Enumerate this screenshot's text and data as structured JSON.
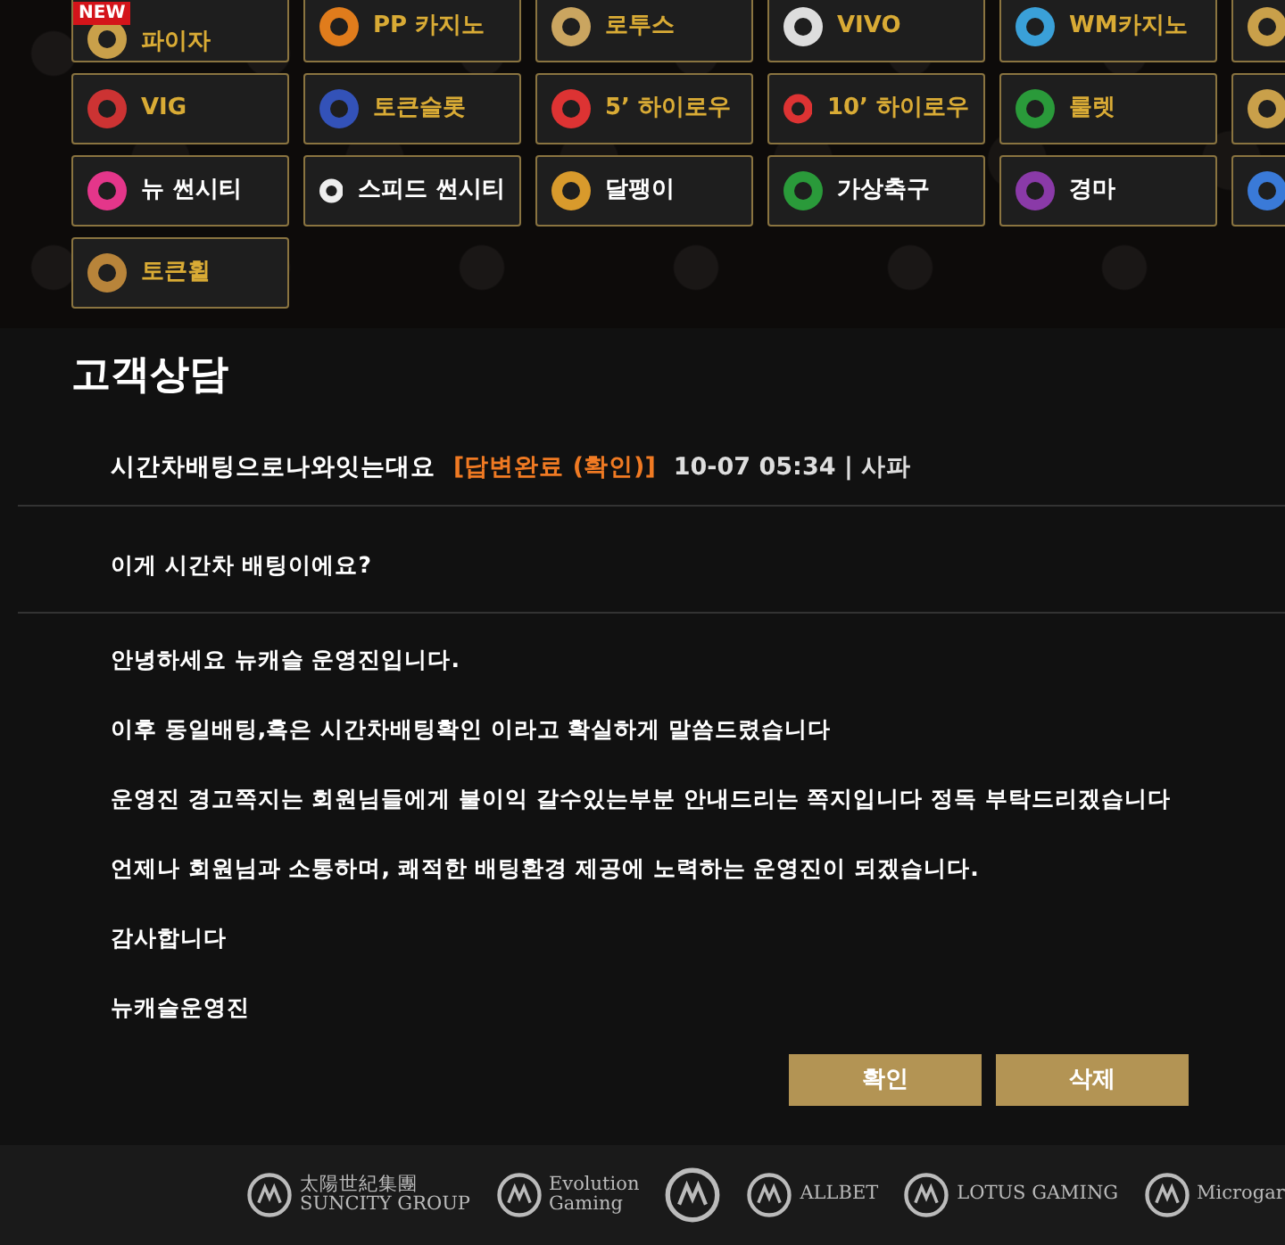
{
  "games": [
    {
      "kind": "labeled",
      "label": "파이자",
      "color": "#d9ab35",
      "badge": "NEW"
    },
    {
      "label": "PP 카지노",
      "color": "#d9ab35"
    },
    {
      "label": "로투스",
      "color": "#d9ab35"
    },
    {
      "label": "VIVO",
      "color": "#d9ab35"
    },
    {
      "label": "WM카지노",
      "color": "#d9ab35"
    },
    {
      "kind": "icon"
    },
    {
      "label": "VIG",
      "color": "#d9ab35"
    },
    {
      "label": "토큰슬롯",
      "color": "#d9ab35"
    },
    {
      "label": "5’ 하이로우",
      "color": "#d9ab35"
    },
    {
      "label": "10’ 하이로우",
      "color": "#d9ab35"
    },
    {
      "label": "룰렛",
      "color": "#d9ab35"
    },
    {
      "kind": "icon"
    },
    {
      "label": "뉴 썬시티",
      "color": "#ffffff"
    },
    {
      "label": "스피드 썬시티",
      "color": "#ffffff"
    },
    {
      "label": "달팽이",
      "color": "#ffffff"
    },
    {
      "label": "가상축구",
      "color": "#ffffff"
    },
    {
      "label": "경마",
      "color": "#ffffff"
    },
    {
      "kind": "icon"
    },
    {
      "label": "토큰휠",
      "color": "#d9ab35"
    }
  ],
  "page_title": "고객상담",
  "inquiry": {
    "subject": "시간차배팅으로나와잇는대요",
    "status": "[답변완료 (확인)]",
    "meta": "10-07 05:34 | 사파",
    "question": "이게 시간차 배팅이에요?",
    "answer": [
      "안녕하세요 뉴캐슬 운영진입니다.",
      "이후 동일배팅,혹은 시간차배팅확인 이라고 확실하게 말씀드렸습니다",
      "운영진 경고쪽지는 회원님들에게 불이익 갈수있는부분 안내드리는 쪽지입니다 정독 부탁드리겠습니다",
      "언제나 회원님과 소통하며, 쾌적한 배팅환경 제공에 노력하는 운영진이 되겠습니다.",
      "감사합니다",
      "뉴캐슬운영진"
    ]
  },
  "buttons": [
    "확인",
    "삭제"
  ],
  "partners": [
    {
      "lines": [
        "太陽世紀集團",
        "SUNCITY GROUP"
      ]
    },
    {
      "lines": [
        "Evolution",
        "Gaming"
      ]
    },
    {
      "kind": "mark"
    },
    {
      "lines": [
        "ALLBET"
      ]
    },
    {
      "lines": [
        "LOTUS GAMING"
      ]
    },
    {
      "lines": [
        "Microgar"
      ]
    }
  ]
}
